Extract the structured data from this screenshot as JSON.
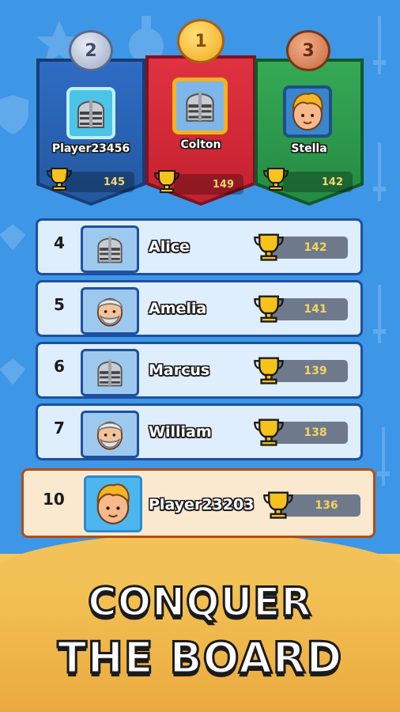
{
  "colors": {
    "background": "#3d96e6",
    "gold": "#f0a81c",
    "silver": "#9aa8c2",
    "bronze": "#c7693d",
    "score_text": "#f5d45c",
    "bottom_band": "#f2c158"
  },
  "podium": [
    {
      "place": "2",
      "name": "Player23456",
      "score": "145",
      "avatar": "knight-helmet-icon",
      "banner_color": "#2f6cc4"
    },
    {
      "place": "1",
      "name": "Colton",
      "score": "149",
      "avatar": "knight-helmet-icon",
      "banner_color": "#e03240"
    },
    {
      "place": "3",
      "name": "Stella",
      "score": "142",
      "avatar": "blond-boy-icon",
      "banner_color": "#35a955"
    }
  ],
  "ranks": [
    {
      "rank": "4",
      "name": "Alice",
      "score": "142",
      "avatar": "knight-helmet-icon"
    },
    {
      "rank": "5",
      "name": "Amelia",
      "score": "141",
      "avatar": "old-man-icon"
    },
    {
      "rank": "6",
      "name": "Marcus",
      "score": "139",
      "avatar": "knight-helmet-icon"
    },
    {
      "rank": "7",
      "name": "William",
      "score": "138",
      "avatar": "old-man-icon"
    }
  ],
  "current_player": {
    "rank": "10",
    "name": "Player23203",
    "score": "136",
    "avatar": "blond-boy-icon"
  },
  "headline": {
    "line1": "CONQUER",
    "line2": "THE BOARD"
  }
}
